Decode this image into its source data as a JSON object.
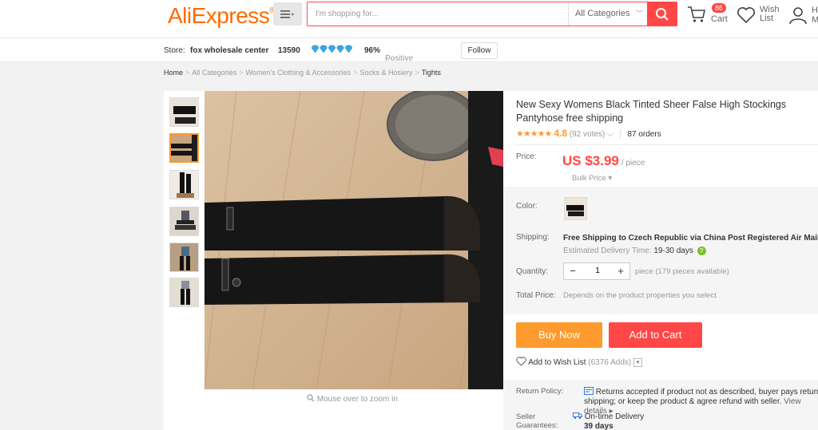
{
  "header": {
    "logo": "AliExpress",
    "search_placeholder": "I'm shopping for...",
    "category_select": "All Categories",
    "cart_count": "86",
    "cart_label": "Cart",
    "wish_label": "Wish List",
    "account_label": "Hi M"
  },
  "store": {
    "prefix": "Store:",
    "name": "fox wholesale center",
    "score": "13590",
    "positive_pct": "96%",
    "feedback_label": "Positive feedback",
    "follow_label": "Follow"
  },
  "breadcrumb": [
    "Home",
    "All Categories",
    "Women's Clothing & Accessories",
    "Socks & Hosiery",
    "Tights"
  ],
  "gallery": {
    "zoom_hint": "Mouse over to zoom in",
    "thumbnail_count": 6,
    "active_thumbnail": 2
  },
  "product": {
    "title": "New Sexy Womens Black Tinted Sheer False High Stockings Pantyhose free shipping",
    "stars": "★★★★★",
    "rating": "4.8",
    "votes": "(92 votes)",
    "orders": "87 orders",
    "price_label": "Price:",
    "price": "US $3.99",
    "price_unit": "/ piece",
    "bulk_price": "Bulk Price ▾",
    "color_label": "Color:",
    "shipping_label": "Shipping:",
    "shipping_text": "Free Shipping to Czech Republic via China Post Registered Air Mail",
    "delivery_prefix": "Estimated Delivery Time:",
    "delivery_days": "19-30 days",
    "quantity_label": "Quantity:",
    "quantity_value": "1",
    "quantity_available": "piece (179 pieces available)",
    "total_label": "Total Price:",
    "total_text": "Depends on the product properties you select",
    "buy_now": "Buy Now",
    "add_to_cart": "Add to Cart",
    "wishlist_label": "Add to Wish List",
    "wishlist_count": "(6376 Adds)",
    "return_label": "Return Policy:",
    "return_text": "Returns accepted if product not as described, buyer pays return shipping; or keep the product & agree refund with seller.",
    "return_link": "View details ▸",
    "guarantee_label": "Seller Guarantees:",
    "guarantee_text": "On-time Delivery",
    "guarantee_days": "39 days"
  },
  "colors": {
    "brand_orange": "#ff6a00",
    "accent_red": "#ff4747",
    "buy_orange": "#ff9a2e"
  }
}
